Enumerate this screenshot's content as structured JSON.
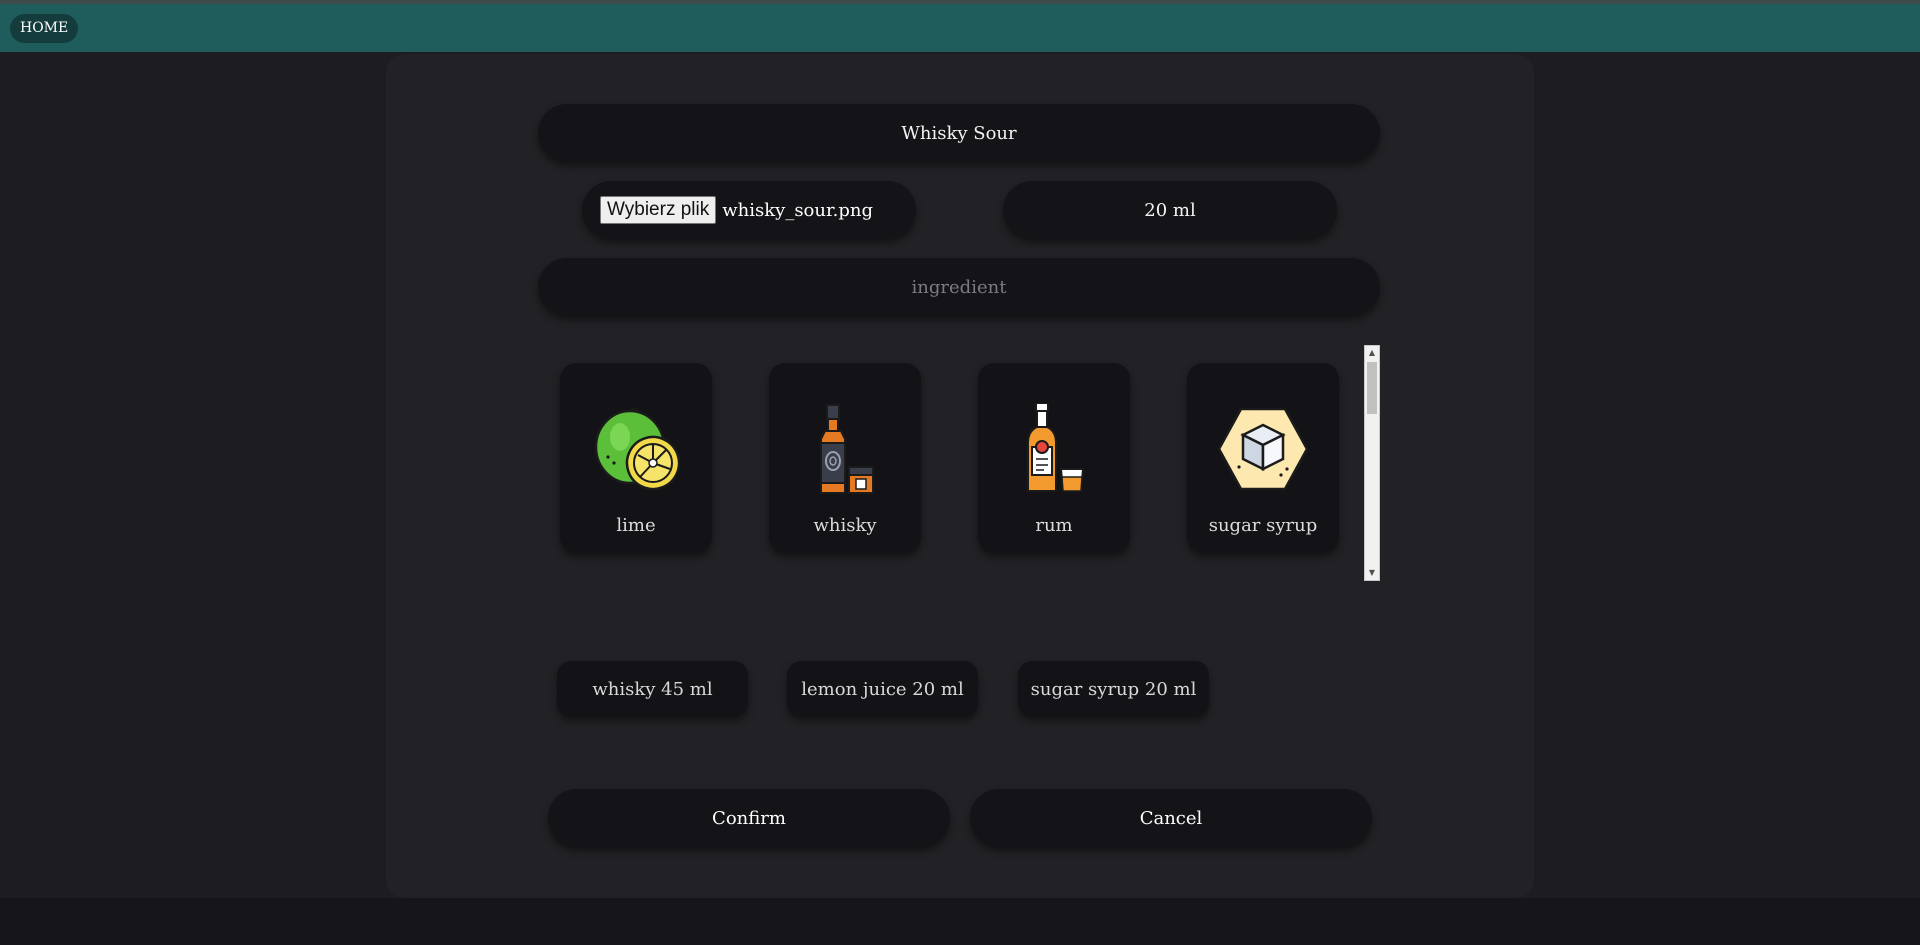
{
  "nav": {
    "home_label": "HOME"
  },
  "form": {
    "cocktail_name": "Whisky Sour",
    "file_button_label": "Wybierz plik",
    "file_name": "whisky_sour.png",
    "amount_value": "20 ml",
    "ingredient_placeholder": "ingredient"
  },
  "ingredients_grid": [
    {
      "label": "lime",
      "icon": "lime-icon"
    },
    {
      "label": "whisky",
      "icon": "whisky-bottle-icon"
    },
    {
      "label": "rum",
      "icon": "rum-bottle-icon"
    },
    {
      "label": "sugar syrup",
      "icon": "sugar-cube-icon"
    }
  ],
  "selected_ingredients": [
    {
      "label": "whisky 45 ml"
    },
    {
      "label": "lemon juice 20 ml"
    },
    {
      "label": "sugar syrup 20 ml"
    }
  ],
  "actions": {
    "confirm_label": "Confirm",
    "cancel_label": "Cancel"
  },
  "colors": {
    "navbar": "#1f5c5c",
    "panel": "#222226",
    "field": "#141418"
  }
}
